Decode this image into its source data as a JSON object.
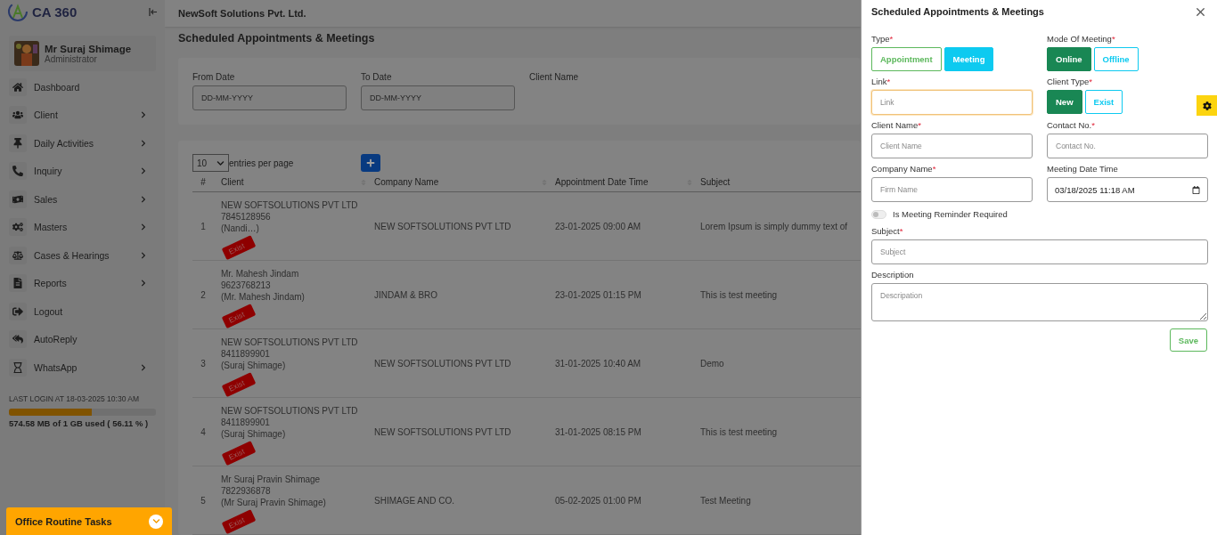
{
  "sidebar": {
    "logo": "CA 360",
    "user": {
      "name": "Mr Suraj Shimage",
      "role": "Administrator"
    },
    "items": [
      {
        "label": "Dashboard",
        "has_children": false
      },
      {
        "label": "Client",
        "has_children": true
      },
      {
        "label": "Daily Activities",
        "has_children": true
      },
      {
        "label": "Inquiry",
        "has_children": true
      },
      {
        "label": "Sales",
        "has_children": true
      },
      {
        "label": "Masters",
        "has_children": true
      },
      {
        "label": "Cases & Hearings",
        "has_children": true
      },
      {
        "label": "Reports",
        "has_children": true
      },
      {
        "label": "Logout",
        "has_children": false
      },
      {
        "label": "AutoReply",
        "has_children": false
      },
      {
        "label": "WhatsApp",
        "has_children": true
      }
    ],
    "last_login": "LAST LOGIN AT 18-03-2025 10:30 AM",
    "storage": {
      "level": 0.5611,
      "text": "574.58 MB of 1 GB used ( 56.11 % )"
    },
    "office_tasks": "Office Routine Tasks"
  },
  "topbar": {
    "company": "NewSoft Solutions Pvt. Ltd."
  },
  "page_title": "Scheduled Appointments & Meetings",
  "filters": [
    {
      "label": "From Date",
      "placeholder": "DD-MM-YYYY",
      "kind": "field"
    },
    {
      "label": "To Date",
      "placeholder": "DD-MM-YYYY",
      "kind": "field"
    },
    {
      "label": "Client Name",
      "kind": "label"
    }
  ],
  "table": {
    "page_size": "10",
    "page_size_label": "entries per page",
    "columns": [
      {
        "label": "#",
        "sortable": false
      },
      {
        "label": "Client",
        "sortable": true
      },
      {
        "label": "Company Name",
        "sortable": true
      },
      {
        "label": "Appointment Date Time",
        "sortable": true
      },
      {
        "label": "Subject",
        "sortable": false
      }
    ],
    "rows": [
      {
        "index": "1",
        "client": [
          "NEW SOFTSOLUTIONS PVT LTD",
          "7845128956",
          "(Nandi…)"
        ],
        "tag": "Exist",
        "company": "NEW SOFTSOLUTIONS PVT LTD",
        "datetime": "23-01-2025 09:00 AM",
        "subject": "Lorem Ipsum is simply dummy text of"
      },
      {
        "index": "2",
        "client": [
          "Mr. Mahesh Jindam",
          "9623768213",
          "(Mr. Mahesh Jindam)"
        ],
        "tag": "Exist",
        "company": "JINDAM & BRO",
        "datetime": "23-01-2025 01:15 PM",
        "subject": "This is test meeting"
      },
      {
        "index": "3",
        "client": [
          "NEW SOFTSOLUTIONS PVT LTD",
          "8411899901",
          "(Suraj Shimage)"
        ],
        "tag": "Exist",
        "company": "NEW SOFTSOLUTIONS PVT LTD",
        "datetime": "31-01-2025 10:40 AM",
        "subject": "Demo"
      },
      {
        "index": "4",
        "client": [
          "NEW SOFTSOLUTIONS PVT LTD",
          "8411899901",
          "(Suraj Shimage)"
        ],
        "tag": "Exist",
        "company": "NEW SOFTSOLUTIONS PVT LTD",
        "datetime": "31-01-2025 08:15 PM",
        "subject": "This is test meeting"
      },
      {
        "index": "5",
        "client": [
          "Mr Suraj Pravin Shimage",
          "7822936878",
          "(Mr Suraj Pravin Shimage)"
        ],
        "tag": "Exist",
        "company": "SHIMAGE AND CO.",
        "datetime": "05-02-2025 01:00 PM",
        "subject": "Test Meeting"
      }
    ]
  },
  "drawer": {
    "title": "Scheduled Appointments & Meetings",
    "type": {
      "label": "Type",
      "mark": "*",
      "options": [
        {
          "label": "Appointment",
          "selected": false
        },
        {
          "label": "Meeting",
          "selected": true
        }
      ]
    },
    "mode": {
      "label": "Mode Of Meeting",
      "mark": "*",
      "options": [
        {
          "label": "Online",
          "selected": true
        },
        {
          "label": "Offline",
          "selected": false
        }
      ]
    },
    "link": {
      "label": "Link",
      "mark": "*",
      "placeholder": "Link",
      "focused": true
    },
    "client_type": {
      "label": "Client Type",
      "mark": "*",
      "options": [
        {
          "label": "New",
          "selected": true
        },
        {
          "label": "Exist",
          "selected": false
        }
      ]
    },
    "client_name": {
      "label": "Client Name",
      "mark": "*",
      "placeholder": "Client Name"
    },
    "contact": {
      "label": "Contact No.",
      "mark": "*",
      "placeholder": "Contact No."
    },
    "company": {
      "label": "Company Name",
      "mark": "*",
      "placeholder": "Firm Name"
    },
    "meeting_time": {
      "label": "Meeting Date Time",
      "value": "03/18/2025 11:18 AM"
    },
    "reminder": {
      "label": "Is Meeting Reminder Required",
      "on": false
    },
    "subject": {
      "label": "Subject",
      "mark": "*",
      "placeholder": "Subject"
    },
    "description": {
      "label": "Description",
      "placeholder": "Descripation"
    },
    "save": "Save"
  }
}
